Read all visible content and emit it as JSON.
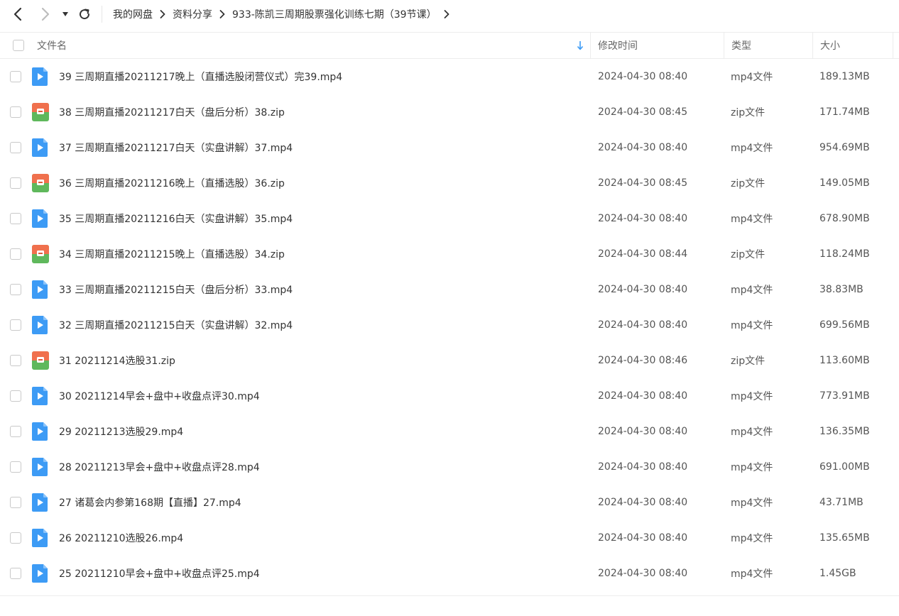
{
  "breadcrumb": [
    "我的网盘",
    "资料分享",
    "933-陈凯三周期股票强化训练七期（39节课）"
  ],
  "columns": {
    "name": "文件名",
    "modified": "修改时间",
    "type": "类型",
    "size": "大小"
  },
  "colors": {
    "video_icon": "#3d9bf5",
    "zip_icon_top": "#f0704d",
    "zip_icon_bottom": "#5fb85c",
    "sort_arrow": "#3d9bf5"
  },
  "files": [
    {
      "name": "39 三周期直播20211217晚上（直播选股闭营仪式）完39.mp4",
      "modified": "2024-04-30 08:40",
      "type": "mp4文件",
      "size": "189.13MB",
      "icon": "video-file-icon"
    },
    {
      "name": "38 三周期直播20211217白天（盘后分析）38.zip",
      "modified": "2024-04-30 08:45",
      "type": "zip文件",
      "size": "171.74MB",
      "icon": "zip-file-icon"
    },
    {
      "name": "37 三周期直播20211217白天（实盘讲解）37.mp4",
      "modified": "2024-04-30 08:40",
      "type": "mp4文件",
      "size": "954.69MB",
      "icon": "video-file-icon"
    },
    {
      "name": "36 三周期直播20211216晚上（直播选股）36.zip",
      "modified": "2024-04-30 08:45",
      "type": "zip文件",
      "size": "149.05MB",
      "icon": "zip-file-icon"
    },
    {
      "name": "35 三周期直播20211216白天（实盘讲解）35.mp4",
      "modified": "2024-04-30 08:40",
      "type": "mp4文件",
      "size": "678.90MB",
      "icon": "video-file-icon"
    },
    {
      "name": "34 三周期直播20211215晚上（直播选股）34.zip",
      "modified": "2024-04-30 08:44",
      "type": "zip文件",
      "size": "118.24MB",
      "icon": "zip-file-icon"
    },
    {
      "name": "33 三周期直播20211215白天（盘后分析）33.mp4",
      "modified": "2024-04-30 08:40",
      "type": "mp4文件",
      "size": "38.83MB",
      "icon": "video-file-icon"
    },
    {
      "name": "32 三周期直播20211215白天（实盘讲解）32.mp4",
      "modified": "2024-04-30 08:40",
      "type": "mp4文件",
      "size": "699.56MB",
      "icon": "video-file-icon"
    },
    {
      "name": "31 20211214选股31.zip",
      "modified": "2024-04-30 08:46",
      "type": "zip文件",
      "size": "113.60MB",
      "icon": "zip-file-icon"
    },
    {
      "name": "30 20211214早会+盘中+收盘点评30.mp4",
      "modified": "2024-04-30 08:40",
      "type": "mp4文件",
      "size": "773.91MB",
      "icon": "video-file-icon"
    },
    {
      "name": "29 20211213选股29.mp4",
      "modified": "2024-04-30 08:40",
      "type": "mp4文件",
      "size": "136.35MB",
      "icon": "video-file-icon"
    },
    {
      "name": "28 20211213早会+盘中+收盘点评28.mp4",
      "modified": "2024-04-30 08:40",
      "type": "mp4文件",
      "size": "691.00MB",
      "icon": "video-file-icon"
    },
    {
      "name": "27 诸葛会内参第168期【直播】27.mp4",
      "modified": "2024-04-30 08:40",
      "type": "mp4文件",
      "size": "43.71MB",
      "icon": "video-file-icon"
    },
    {
      "name": "26 20211210选股26.mp4",
      "modified": "2024-04-30 08:40",
      "type": "mp4文件",
      "size": "135.65MB",
      "icon": "video-file-icon"
    },
    {
      "name": "25 20211210早会+盘中+收盘点评25.mp4",
      "modified": "2024-04-30 08:40",
      "type": "mp4文件",
      "size": "1.45GB",
      "icon": "video-file-icon"
    }
  ]
}
